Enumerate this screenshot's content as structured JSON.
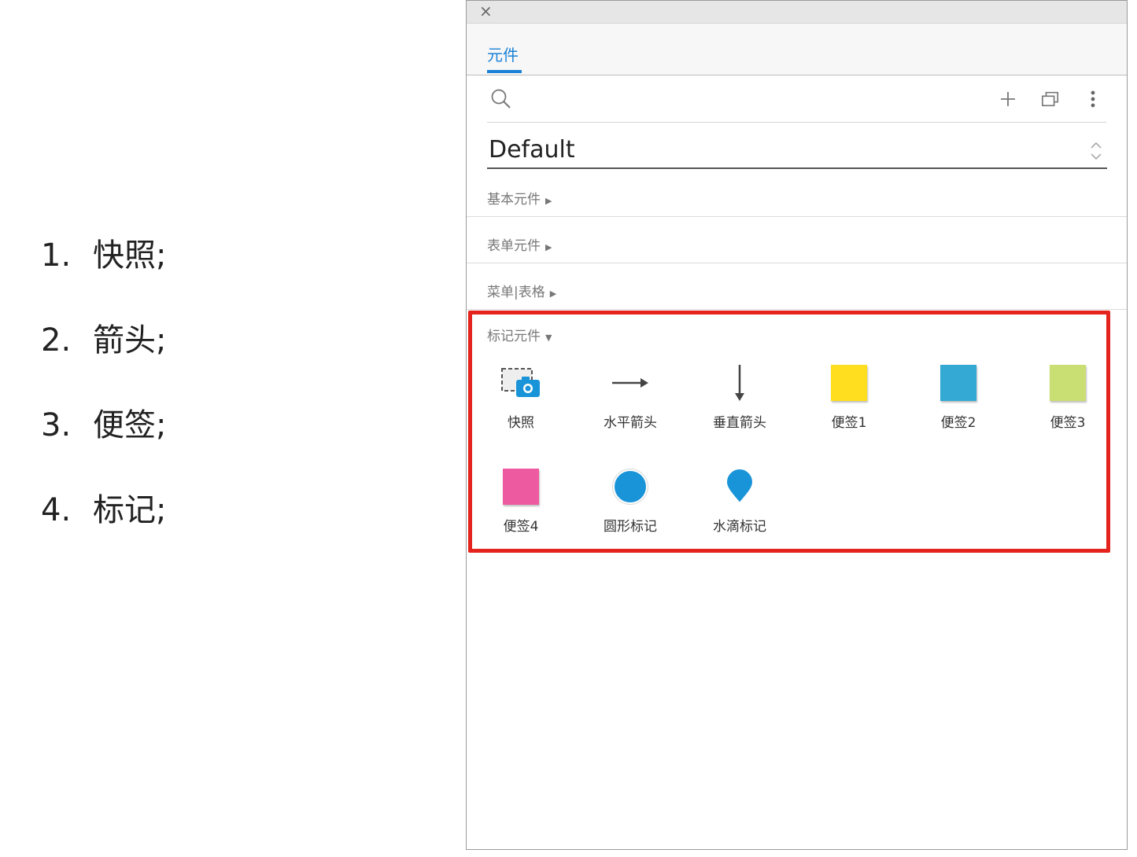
{
  "notes": [
    {
      "num": "1.",
      "text": "快照;"
    },
    {
      "num": "2.",
      "text": "箭头;"
    },
    {
      "num": "3.",
      "text": "便签;"
    },
    {
      "num": "4.",
      "text": "标记;"
    }
  ],
  "panel": {
    "close_glyph": "×",
    "tab_label": "元件",
    "library_name": "Default",
    "sections": [
      "基本元件",
      "表单元件",
      "菜单|表格"
    ],
    "marker_section": "标记元件",
    "widgets": [
      {
        "label": "快照",
        "icon": "snapshot-icon"
      },
      {
        "label": "水平箭头",
        "icon": "horizontal-arrow-icon"
      },
      {
        "label": "垂直箭头",
        "icon": "vertical-arrow-icon"
      },
      {
        "label": "便签1",
        "icon": "sticky-note-icon",
        "color": "#ffdd1f"
      },
      {
        "label": "便签2",
        "icon": "sticky-note-icon",
        "color": "#33a9d4"
      },
      {
        "label": "便签3",
        "icon": "sticky-note-icon",
        "color": "#c9de73"
      },
      {
        "label": "便签4",
        "icon": "sticky-note-icon",
        "color": "#ee5aa0"
      },
      {
        "label": "圆形标记",
        "icon": "circle-marker-icon",
        "color": "#1a94d8"
      },
      {
        "label": "水滴标记",
        "icon": "drop-marker-icon",
        "color": "#1a94d8"
      }
    ]
  },
  "colors": {
    "accent": "#1a82d6",
    "highlight": "#e3231c"
  }
}
